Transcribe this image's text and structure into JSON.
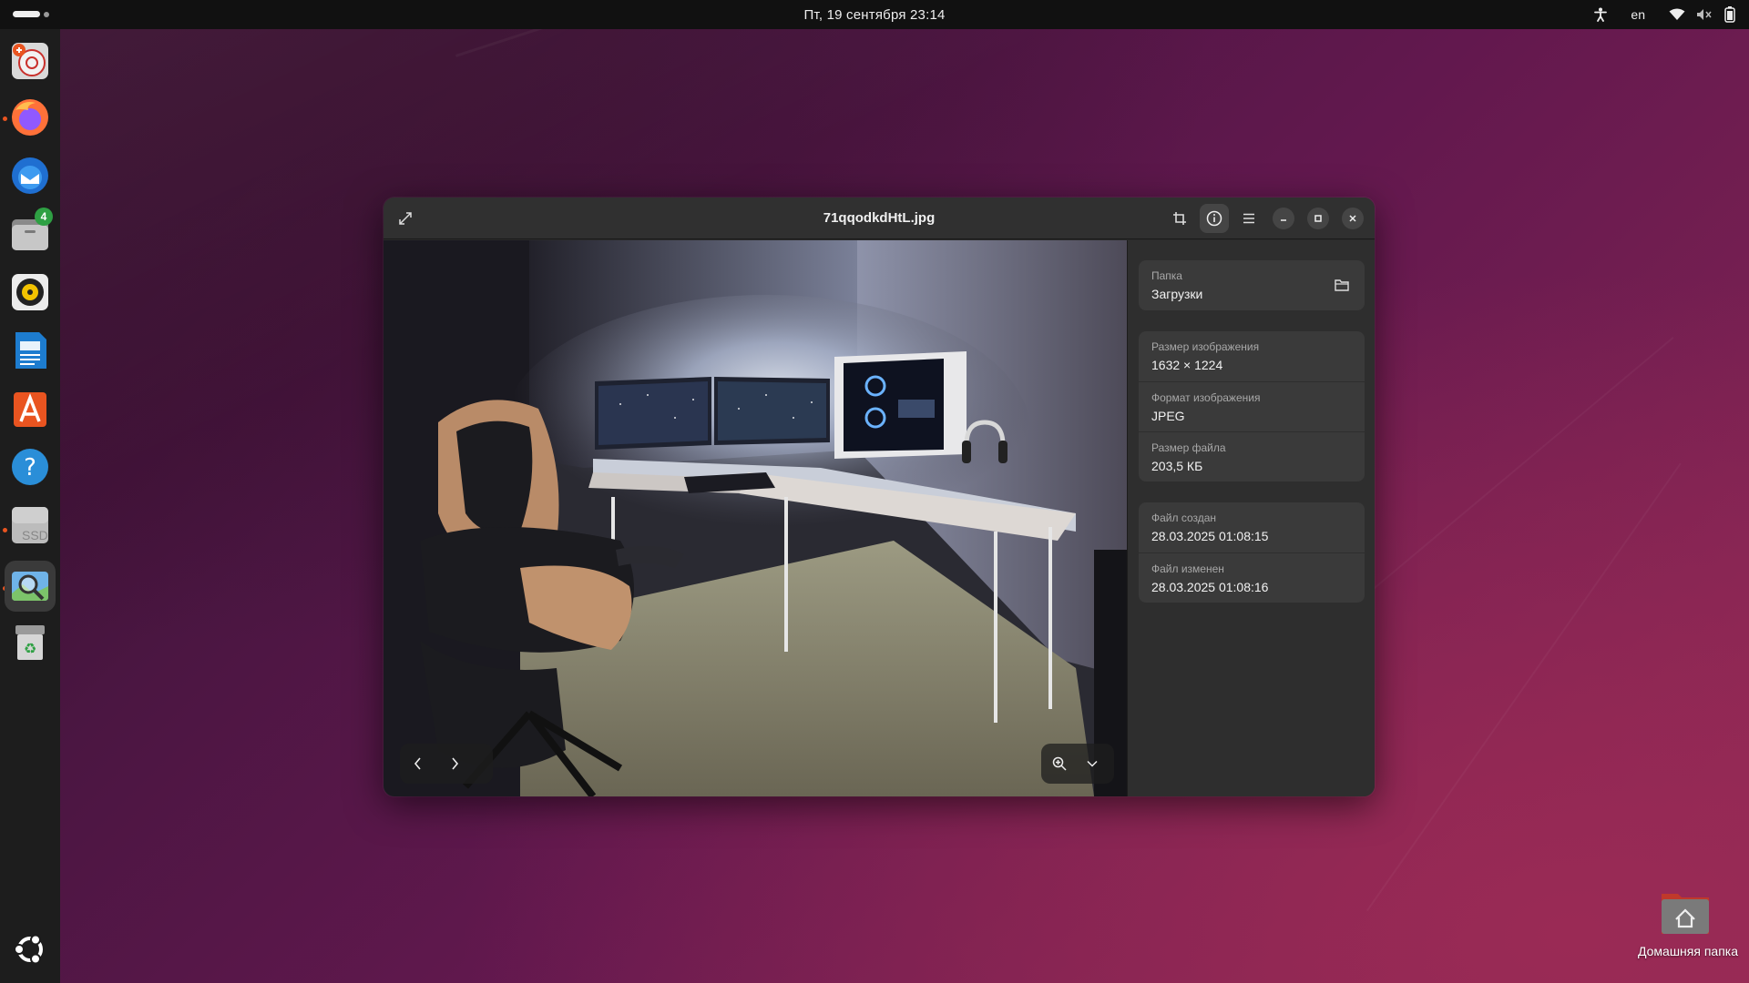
{
  "topbar": {
    "clock": "Пт, 19 сентября  23:14",
    "keyboard_layout": "en",
    "icons": [
      "accessibility-icon",
      "wifi-icon",
      "volume-muted-icon",
      "battery-icon"
    ]
  },
  "dock": {
    "items": [
      {
        "name": "disk-usage-analyzer",
        "running": false
      },
      {
        "name": "firefox",
        "running": true
      },
      {
        "name": "thunderbird",
        "running": false
      },
      {
        "name": "files",
        "running": false,
        "badge": "4"
      },
      {
        "name": "rhythmbox",
        "running": false
      },
      {
        "name": "libreoffice-writer",
        "running": false
      },
      {
        "name": "app-center",
        "running": false
      },
      {
        "name": "help",
        "running": false
      },
      {
        "name": "ssd-drive",
        "running": true,
        "label": "SSD"
      },
      {
        "name": "image-viewer",
        "running": true,
        "active": true
      },
      {
        "name": "trash",
        "running": false
      }
    ],
    "show_apps_icon": "ubuntu-logo-icon"
  },
  "window": {
    "title": "71qqodkdHtL.jpg",
    "active_panel": "info",
    "properties": {
      "folder": {
        "label": "Папка",
        "value": "Загрузки"
      },
      "image_size": {
        "label": "Размер изображения",
        "value": "1632 × 1224"
      },
      "image_format": {
        "label": "Формат изображения",
        "value": "JPEG"
      },
      "file_size": {
        "label": "Размер файла",
        "value": "203,5 КБ"
      },
      "created": {
        "label": "Файл создан",
        "value": "28.03.2025 01:08:15"
      },
      "modified": {
        "label": "Файл изменен",
        "value": "28.03.2025 01:08:16"
      }
    }
  },
  "desktop": {
    "home_folder_label": "Домашняя папка"
  },
  "colors": {
    "accent": "#e95420",
    "badge": "#2ea043",
    "window_bg": "#2b2b2b",
    "card_bg": "#3a3a3a"
  }
}
